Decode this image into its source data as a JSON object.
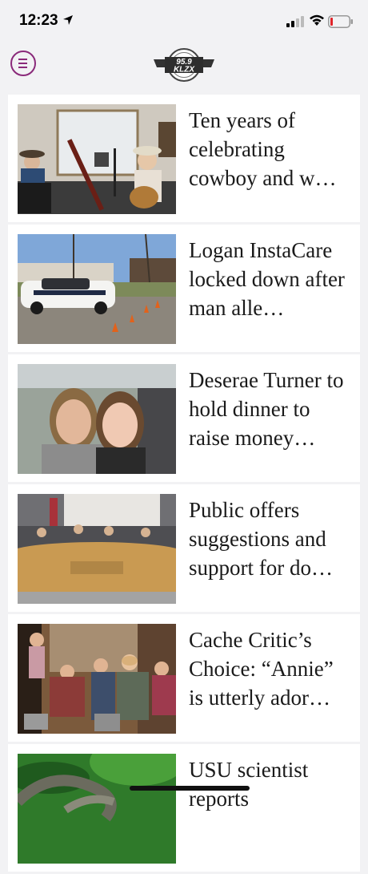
{
  "status": {
    "time": "12:23"
  },
  "header": {
    "logo_line1": "95.9",
    "logo_line2": "KLZX"
  },
  "articles": [
    {
      "headline": "Ten years of celebrating cowboy and w…",
      "image_icon": "cowboy-musicians-photo"
    },
    {
      "headline": "Logan InstaCare locked down after man alle…",
      "image_icon": "police-car-photo"
    },
    {
      "headline": "Deserae Turner to hold dinner to raise money…",
      "image_icon": "two-women-photo"
    },
    {
      "headline": "Public offers suggestions and support for do…",
      "image_icon": "city-council-photo"
    },
    {
      "headline": "Cache Critic’s Choice: “Annie” is utterly ador…",
      "image_icon": "theater-cast-photo"
    },
    {
      "headline": "USU scientist reports",
      "image_icon": "snake-photo"
    }
  ],
  "colors": {
    "accent": "#8a2a7a",
    "background": "#f2f2f4",
    "card": "#ffffff"
  }
}
